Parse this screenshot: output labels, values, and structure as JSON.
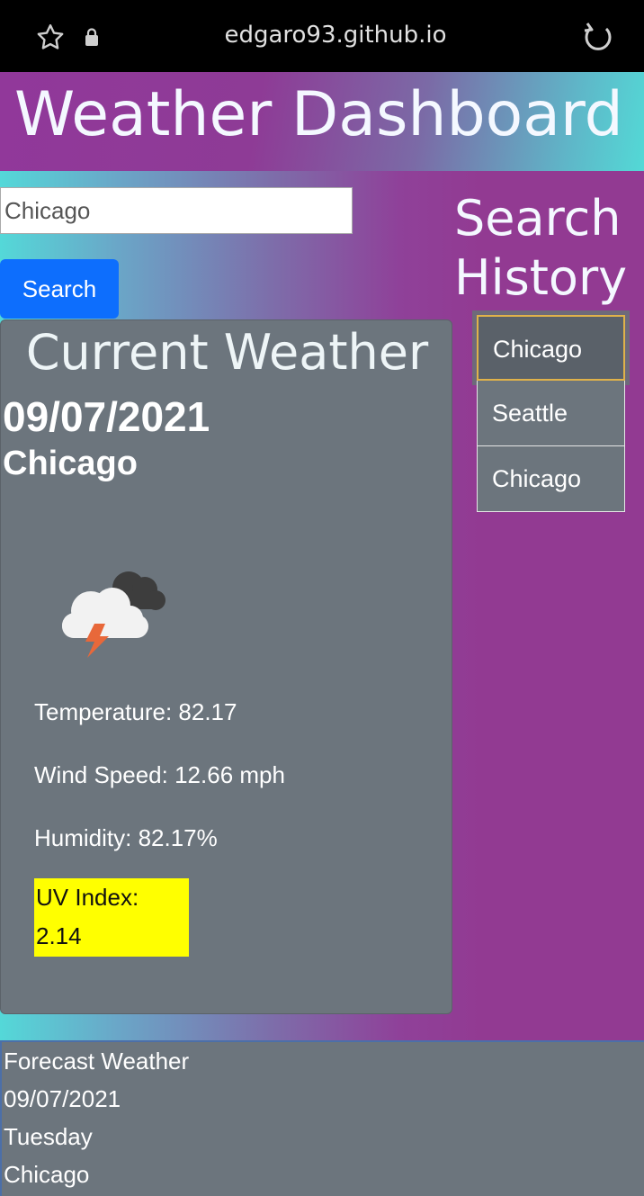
{
  "browser": {
    "url": "edgaro93.github.io",
    "icons": [
      "star-icon",
      "lock-icon",
      "reload-icon"
    ]
  },
  "header": {
    "title": "Weather Dashboard"
  },
  "search": {
    "value": "Chicago",
    "placeholder": "",
    "button_label": "Search"
  },
  "history": {
    "title_line1": "Search",
    "title_line2": "History",
    "items": [
      "Chicago",
      "Seattle",
      "Chicago"
    ]
  },
  "current": {
    "title": "Current Weather",
    "date": "09/07/2021",
    "city": "Chicago",
    "icon": "thunderstorm-icon",
    "temperature": "Temperature: 82.17",
    "wind": "Wind Speed: 12.66 mph",
    "humidity": "Humidity: 82.17%",
    "uv_label": "UV Index:",
    "uv_value": "2.14"
  },
  "forecast": {
    "title": "Forecast Weather",
    "date": "09/07/2021",
    "day": "Tuesday",
    "city": "Chicago"
  },
  "colors": {
    "card": "#6c757d",
    "button": "#0d6efd",
    "uv": "#ffff00",
    "page": "#923a92"
  }
}
